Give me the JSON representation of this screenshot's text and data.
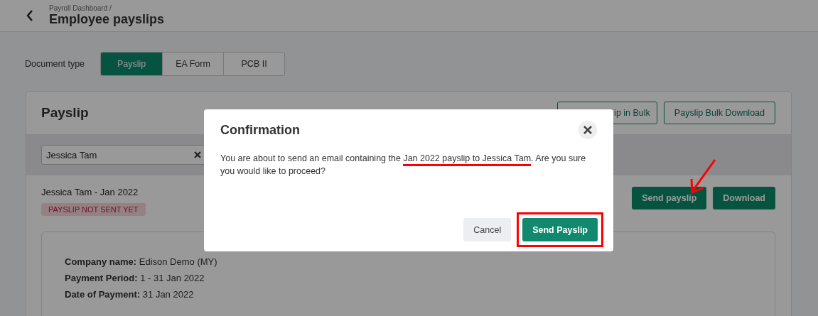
{
  "header": {
    "breadcrumb": "Payroll Dashboard /",
    "title": "Employee payslips"
  },
  "document_type": {
    "label": "Document type",
    "tabs": [
      {
        "label": "Payslip",
        "selected": true
      },
      {
        "label": "EA Form",
        "selected": false
      },
      {
        "label": "PCB II",
        "selected": false
      }
    ]
  },
  "card": {
    "title": "Payslip",
    "actions": [
      "ip in Bulk",
      "Payslip Bulk Download"
    ],
    "employee_filter": {
      "value": "Jessica Tam"
    },
    "entry": {
      "title": "Jessica Tam - Jan 2022",
      "status": "PAYSLIP NOT SENT YET",
      "actions": [
        "Send payslip",
        "Download"
      ],
      "details": [
        {
          "label": "Company name:",
          "value": "Edison Demo (MY)"
        },
        {
          "label": "Payment Period:",
          "value": "1 - 31 Jan 2022"
        },
        {
          "label": "Date of Payment:",
          "value": "31 Jan 2022"
        }
      ]
    }
  },
  "dialog": {
    "title": "Confirmation",
    "message": {
      "before": "You are about to send an email containing the ",
      "highlight": "Jan 2022 payslip to Jessica Tam",
      "underlined": true,
      "after": ". Are you sure you would like to proceed?"
    },
    "buttons": [
      {
        "label": "Cancel",
        "kind": "secondary",
        "highlighted": false
      },
      {
        "label": "Send Payslip",
        "kind": "primary",
        "highlighted": true
      }
    ]
  },
  "annotation_arrow": {
    "kind": "arrow"
  }
}
